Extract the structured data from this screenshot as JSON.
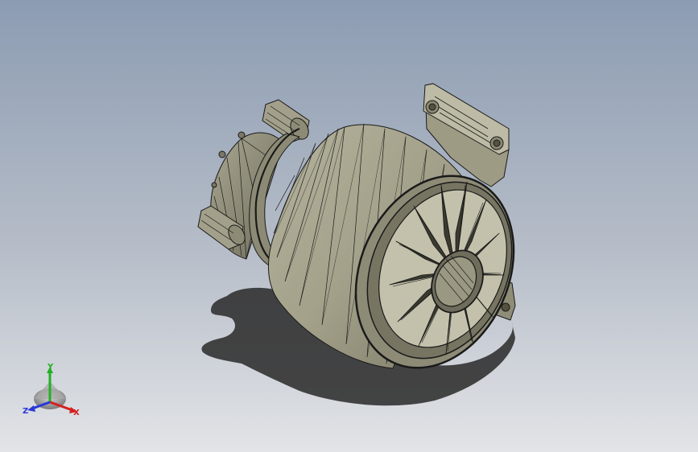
{
  "viewport": {
    "background_top": "#8b9bb1",
    "background_bottom": "#dde0e4",
    "model_color": "#a8a690",
    "edge_color": "#1a1a1a",
    "shadow_color": "#2b2b2b"
  },
  "triad": {
    "x_label": "X",
    "y_label": "Y",
    "z_label": "Z",
    "x_color": "#d42020",
    "y_color": "#22b022",
    "z_color": "#2838d8"
  }
}
